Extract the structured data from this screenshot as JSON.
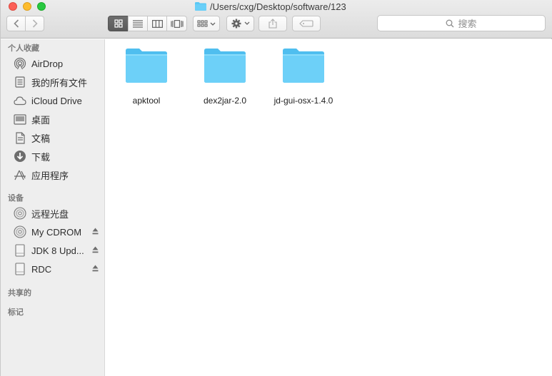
{
  "window": {
    "title": "/Users/cxg/Desktop/software/123"
  },
  "toolbar": {
    "search_placeholder": "搜索"
  },
  "sidebar": {
    "favorites_header": "个人收藏",
    "favorites": [
      {
        "label": "AirDrop",
        "icon": "airdrop-icon"
      },
      {
        "label": "我的所有文件",
        "icon": "all-files-icon"
      },
      {
        "label": "iCloud Drive",
        "icon": "cloud-icon"
      },
      {
        "label": "桌面",
        "icon": "desktop-icon"
      },
      {
        "label": "文稿",
        "icon": "document-icon"
      },
      {
        "label": "下载",
        "icon": "download-icon"
      },
      {
        "label": "应用程序",
        "icon": "applications-icon"
      }
    ],
    "devices_header": "设备",
    "devices": [
      {
        "label": "远程光盘",
        "icon": "disc-icon",
        "eject": false
      },
      {
        "label": "My CDROM",
        "icon": "disc-icon",
        "eject": true
      },
      {
        "label": "JDK 8 Upd...",
        "icon": "drive-icon",
        "eject": true
      },
      {
        "label": "RDC",
        "icon": "drive-icon",
        "eject": true
      }
    ],
    "shared_header": "共享的",
    "tags_header": "标记"
  },
  "files": [
    {
      "name": "apktool",
      "icon": "folder-icon"
    },
    {
      "name": "dex2jar-2.0",
      "icon": "folder-icon"
    },
    {
      "name": "jd-gui-osx-1.4.0",
      "icon": "folder-icon"
    }
  ],
  "colors": {
    "folder": "#5ac8f5",
    "folder_tab": "#7dd5f8",
    "sidebar_bg": "#eeeeee",
    "selected_view": "#636363"
  }
}
